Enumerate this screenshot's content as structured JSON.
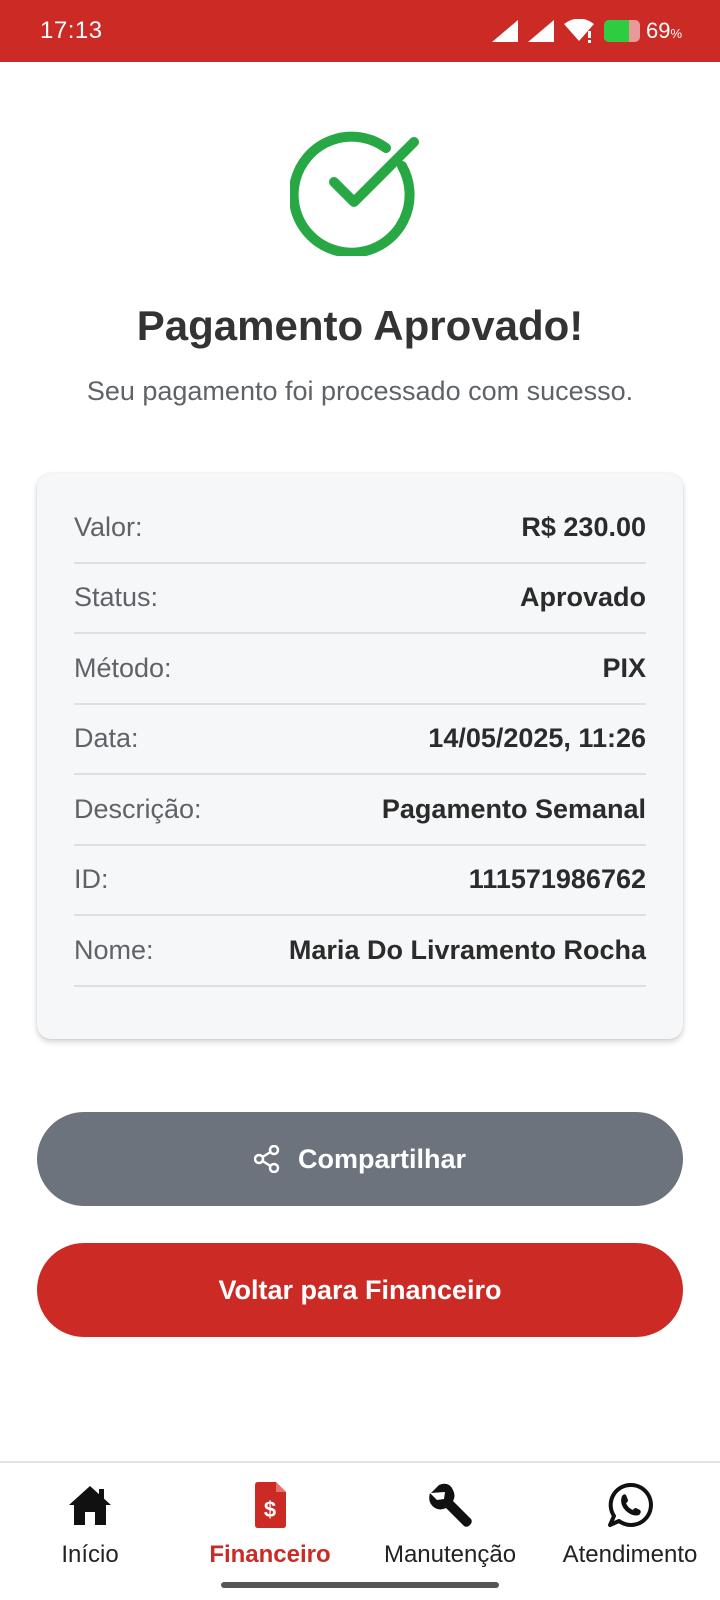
{
  "status_bar": {
    "time": "17:13",
    "battery_percent": "69",
    "battery_unit": "%",
    "battery_level": 0.69
  },
  "colors": {
    "brand_red": "#cc2a24",
    "success_green": "#27a844",
    "share_gray": "#6c737d"
  },
  "header": {
    "success_icon": "check-circle-icon",
    "title": "Pagamento Aprovado!",
    "subtitle": "Seu pagamento foi processado com sucesso."
  },
  "details": [
    {
      "label": "Valor:",
      "value": "R$ 230.00"
    },
    {
      "label": "Status:",
      "value": "Aprovado"
    },
    {
      "label": "Método:",
      "value": "PIX"
    },
    {
      "label": "Data:",
      "value": "14/05/2025, 11:26"
    },
    {
      "label": "Descrição:",
      "value": "Pagamento Semanal"
    },
    {
      "label": "ID:",
      "value": "111571986762"
    },
    {
      "label": "Nome:",
      "value": "Maria Do Livramento Rocha"
    }
  ],
  "actions": {
    "share_icon": "share-icon",
    "share_label": "Compartilhar",
    "back_label": "Voltar para Financeiro"
  },
  "nav": {
    "active": "Financeiro",
    "items": [
      {
        "label": "Início",
        "icon": "home-icon"
      },
      {
        "label": "Financeiro",
        "icon": "invoice-dollar-icon"
      },
      {
        "label": "Manutenção",
        "icon": "wrench-icon"
      },
      {
        "label": "Atendimento",
        "icon": "whatsapp-icon"
      }
    ]
  }
}
